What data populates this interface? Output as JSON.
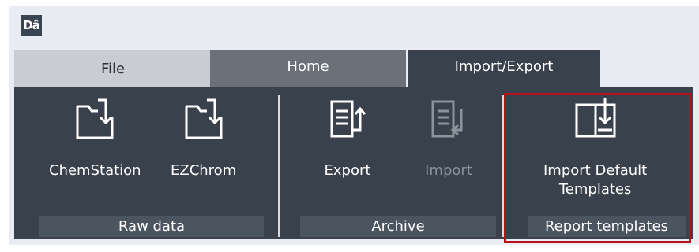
{
  "app": {
    "logo_text": "Dâ"
  },
  "tabs": [
    {
      "label": "File"
    },
    {
      "label": "Home"
    },
    {
      "label": "Import/Export"
    }
  ],
  "ribbon": {
    "groups": [
      {
        "label": "Raw data",
        "commands": [
          {
            "label": "ChemStation",
            "icon": "import-folder-icon",
            "enabled": true
          },
          {
            "label": "EZChrom",
            "icon": "import-folder-icon",
            "enabled": true
          }
        ]
      },
      {
        "label": "Archive",
        "commands": [
          {
            "label": "Export",
            "icon": "export-document-icon",
            "enabled": true
          },
          {
            "label": "Import",
            "icon": "import-document-icon",
            "enabled": false
          }
        ]
      },
      {
        "label": "Report templates",
        "commands": [
          {
            "label_line1": "Import Default",
            "label_line2": "Templates",
            "icon": "import-templates-icon",
            "enabled": true
          }
        ]
      }
    ]
  },
  "colors": {
    "ribbon_bg": "#39424c",
    "highlight": "#b5121b",
    "frame_bg": "#e9edf3"
  }
}
